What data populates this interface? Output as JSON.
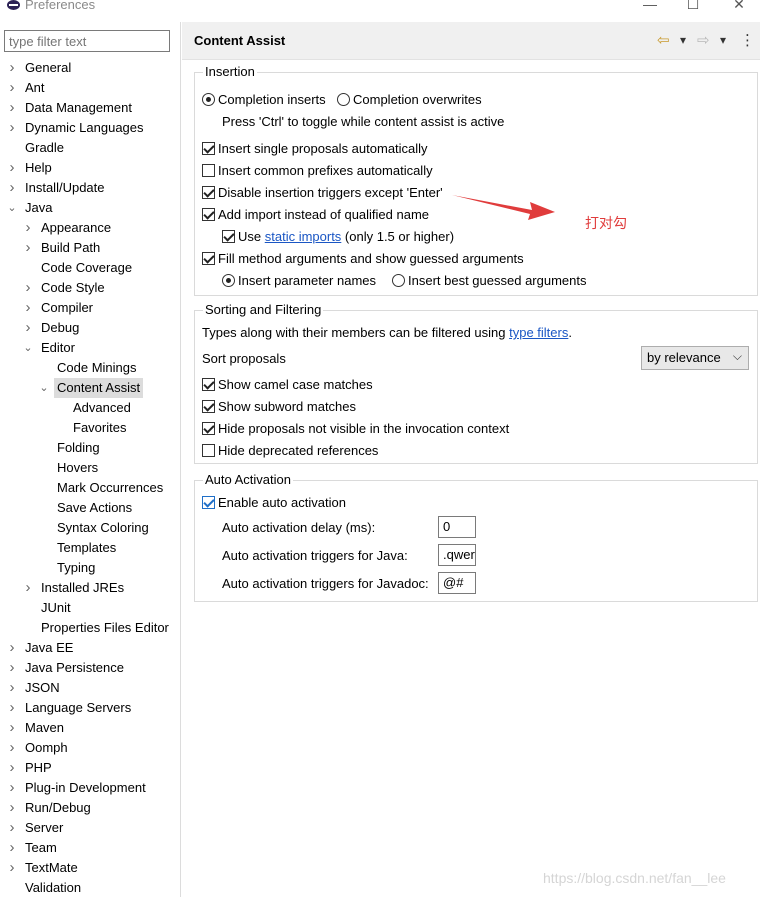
{
  "window": {
    "title": "Preferences",
    "minimize_icon": "—",
    "maximize_icon": "☐",
    "close_icon": "✕"
  },
  "filter": {
    "placeholder": "type filter text"
  },
  "tree": [
    {
      "label": "General",
      "depth": 0,
      "expander": "collapsed"
    },
    {
      "label": "Ant",
      "depth": 0,
      "expander": "collapsed"
    },
    {
      "label": "Data Management",
      "depth": 0,
      "expander": "collapsed"
    },
    {
      "label": "Dynamic Languages",
      "depth": 0,
      "expander": "collapsed"
    },
    {
      "label": "Gradle",
      "depth": 0,
      "expander": "none"
    },
    {
      "label": "Help",
      "depth": 0,
      "expander": "collapsed"
    },
    {
      "label": "Install/Update",
      "depth": 0,
      "expander": "collapsed"
    },
    {
      "label": "Java",
      "depth": 0,
      "expander": "expanded"
    },
    {
      "label": "Appearance",
      "depth": 1,
      "expander": "collapsed"
    },
    {
      "label": "Build Path",
      "depth": 1,
      "expander": "collapsed"
    },
    {
      "label": "Code Coverage",
      "depth": 1,
      "expander": "none"
    },
    {
      "label": "Code Style",
      "depth": 1,
      "expander": "collapsed"
    },
    {
      "label": "Compiler",
      "depth": 1,
      "expander": "collapsed"
    },
    {
      "label": "Debug",
      "depth": 1,
      "expander": "collapsed"
    },
    {
      "label": "Editor",
      "depth": 1,
      "expander": "expanded"
    },
    {
      "label": "Code Minings",
      "depth": 2,
      "expander": "none"
    },
    {
      "label": "Content Assist",
      "depth": 2,
      "expander": "expanded",
      "selected": true
    },
    {
      "label": "Advanced",
      "depth": 3,
      "expander": "none"
    },
    {
      "label": "Favorites",
      "depth": 3,
      "expander": "none"
    },
    {
      "label": "Folding",
      "depth": 2,
      "expander": "none"
    },
    {
      "label": "Hovers",
      "depth": 2,
      "expander": "none"
    },
    {
      "label": "Mark Occurrences",
      "depth": 2,
      "expander": "none"
    },
    {
      "label": "Save Actions",
      "depth": 2,
      "expander": "none"
    },
    {
      "label": "Syntax Coloring",
      "depth": 2,
      "expander": "none"
    },
    {
      "label": "Templates",
      "depth": 2,
      "expander": "none"
    },
    {
      "label": "Typing",
      "depth": 2,
      "expander": "none"
    },
    {
      "label": "Installed JREs",
      "depth": 1,
      "expander": "collapsed"
    },
    {
      "label": "JUnit",
      "depth": 1,
      "expander": "none"
    },
    {
      "label": "Properties Files Editor",
      "depth": 1,
      "expander": "none"
    },
    {
      "label": "Java EE",
      "depth": 0,
      "expander": "collapsed"
    },
    {
      "label": "Java Persistence",
      "depth": 0,
      "expander": "collapsed"
    },
    {
      "label": "JSON",
      "depth": 0,
      "expander": "collapsed"
    },
    {
      "label": "Language Servers",
      "depth": 0,
      "expander": "collapsed"
    },
    {
      "label": "Maven",
      "depth": 0,
      "expander": "collapsed"
    },
    {
      "label": "Oomph",
      "depth": 0,
      "expander": "collapsed"
    },
    {
      "label": "PHP",
      "depth": 0,
      "expander": "collapsed"
    },
    {
      "label": "Plug-in Development",
      "depth": 0,
      "expander": "collapsed"
    },
    {
      "label": "Run/Debug",
      "depth": 0,
      "expander": "collapsed"
    },
    {
      "label": "Server",
      "depth": 0,
      "expander": "collapsed"
    },
    {
      "label": "Team",
      "depth": 0,
      "expander": "collapsed"
    },
    {
      "label": "TextMate",
      "depth": 0,
      "expander": "collapsed"
    },
    {
      "label": "Validation",
      "depth": 0,
      "expander": "none"
    }
  ],
  "page": {
    "title": "Content Assist",
    "back_icon": "⇦",
    "forward_icon": "⇨",
    "dropdown_icon": "▾",
    "menu_icon": "⋮"
  },
  "insertion": {
    "legend": "Insertion",
    "radio_inserts": "Completion inserts",
    "radio_overwrites": "Completion overwrites",
    "hint": "Press 'Ctrl' to toggle while content assist is active",
    "single_proposals": "Insert single proposals automatically",
    "common_prefixes": "Insert common prefixes automatically",
    "disable_triggers": "Disable insertion triggers except 'Enter'",
    "add_import": "Add import instead of qualified name",
    "use_static_prefix": "Use ",
    "static_imports_link": "static imports",
    "use_static_suffix": " (only 1.5 or higher)",
    "fill_method_args": "Fill method arguments and show guessed arguments",
    "insert_param_names": "Insert parameter names",
    "insert_best_guessed": "Insert best guessed arguments"
  },
  "sorting": {
    "legend": "Sorting and Filtering",
    "types_text": "Types along with their members can be filtered using ",
    "type_filters_link": "type filters",
    "types_end": ".",
    "sort_proposals": "Sort proposals",
    "sort_value": "by relevance",
    "camel_case": "Show camel case matches",
    "subword": "Show subword matches",
    "hide_not_visible": "Hide proposals not visible in the invocation context",
    "hide_deprecated": "Hide deprecated references"
  },
  "auto": {
    "legend": "Auto Activation",
    "enable": "Enable auto activation",
    "delay_label": "Auto activation delay (ms):",
    "delay_value": "0",
    "java_label": "Auto activation triggers for Java:",
    "java_value": ".qwer",
    "javadoc_label": "Auto activation triggers for Javadoc:",
    "javadoc_value": "@#"
  },
  "annotation": {
    "text": "打对勾",
    "color": "#e03c3c"
  },
  "watermark": "https://blog.csdn.net/fan__lee"
}
